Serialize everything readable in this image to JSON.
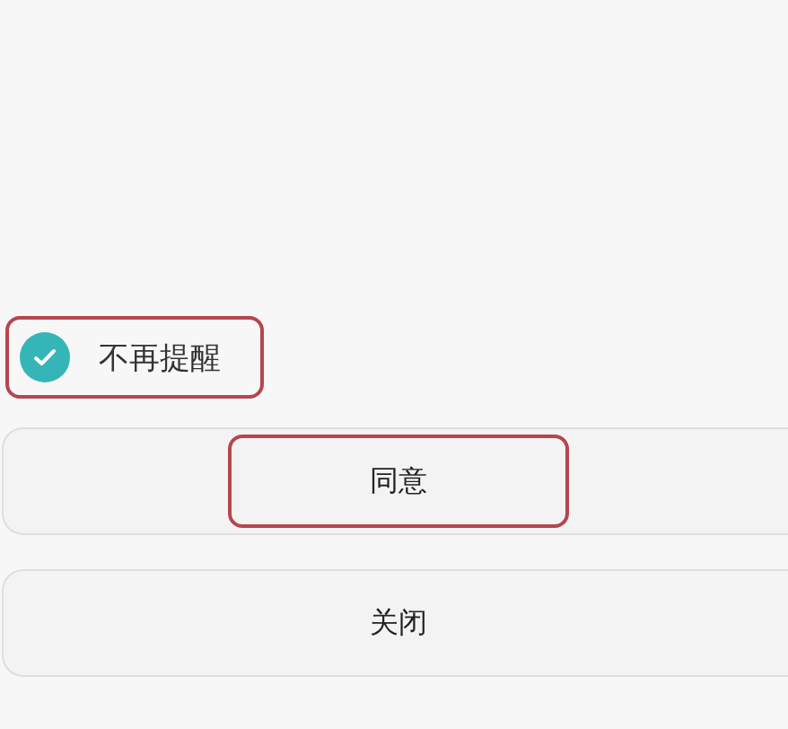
{
  "option": {
    "label": "不再提醒",
    "checked": true,
    "highlighted": true
  },
  "buttons": [
    {
      "label": "同意",
      "highlighted": true
    },
    {
      "label": "关闭",
      "highlighted": false
    }
  ]
}
